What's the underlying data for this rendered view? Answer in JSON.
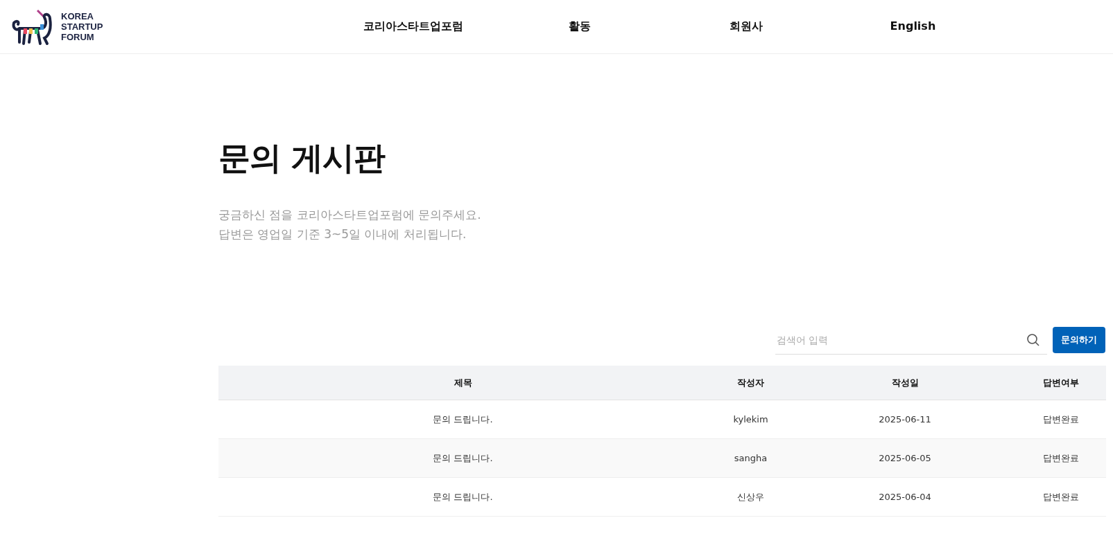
{
  "header": {
    "logo_lines": [
      "KOREA",
      "STARTUP",
      "FORUM"
    ],
    "nav": [
      "코리아스타트업포럼",
      "활동",
      "회원사",
      "English"
    ]
  },
  "page": {
    "title": "문의 게시판",
    "description": [
      "궁금하신 점을 코리아스타트업포럼에 문의주세요.",
      "답변은 영업일 기준 3~5일 이내에 처리됩니다."
    ]
  },
  "search": {
    "placeholder": "검색어 입력"
  },
  "write_button": "문의하기",
  "table": {
    "columns": [
      "제목",
      "작성자",
      "작성일",
      "답변여부"
    ],
    "rows": [
      {
        "cells": [
          "문의 드립니다.",
          "kylekim",
          "2025-06-11",
          "답변완료"
        ]
      },
      {
        "cells": [
          "문의 드립니다.",
          "sangha",
          "2025-06-05",
          "답변완료"
        ]
      },
      {
        "cells": [
          "문의 드립니다.",
          "신상우",
          "2025-06-04",
          "답변완료"
        ]
      }
    ]
  }
}
